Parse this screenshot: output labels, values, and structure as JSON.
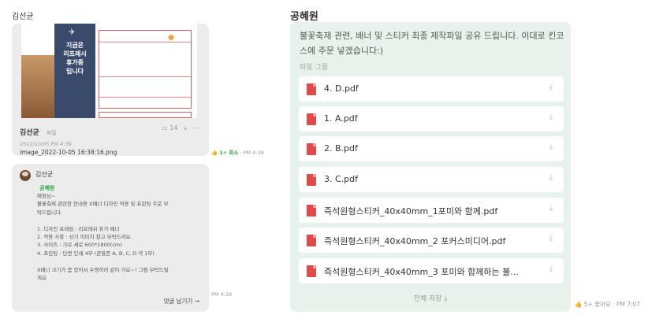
{
  "left": {
    "sender_top": "김선균",
    "image_message": {
      "thumb_lines": [
        "지금은",
        "리프레시",
        "휴가중",
        "입니다"
      ],
      "sender": "김선균",
      "type_label": "파일",
      "date": "2022/10/05 PM 4:39",
      "filename": "image_2022-10-05 16:38:16.png",
      "comment_count": "14",
      "reaction": "1+ 회소",
      "time": "PM 4:39"
    },
    "text_message": {
      "sender": "김선균",
      "mention": "공혜원",
      "body": "혜원님~\n불꽃축제 관련한 안내용 X배너 디자인 적용 및 프린팅 주문 부\n탁드립니다.\n\n1. 디자인 프레임 : 리프레쉬 휴가 배너\n2. 적용 사항 : 상기 이미지 참고 부탁드려요.\n3. 사이즈 : 가로 세로 600*1800(cm)\n4. 프린팅 : 단면 인쇄 4부 (관할존 A, B, C, D 각 1부)\n\nX배너 크기가 좀 있어서 수령하러 같이 가요~! 그럼 부탁드릴\n게요",
      "reply_label": "댓글 남기기 →",
      "time": "PM 4:39"
    }
  },
  "right": {
    "sender": "공혜원",
    "message": "불꽃축제 관련, 배너 및 스티커 최종 제작파일 공유 드립니다. 이대로 킨코스에 주문 넣겠습니다:)",
    "group_label": "파일 그룹",
    "files": [
      {
        "name": "4. D.pdf"
      },
      {
        "name": "1. A.pdf"
      },
      {
        "name": "2. B.pdf"
      },
      {
        "name": "3. C.pdf"
      },
      {
        "name": "즉석원형스티커_40x40mm_1포미와 함께.pdf"
      },
      {
        "name": "즉석원형스티커_40x40mm_2 포커스미디어.pdf"
      },
      {
        "name": "즉석원형스티커_40x40mm_3 포미와 함께하는 불..."
      }
    ],
    "save_all_label": "전체 저장 ⤓",
    "reaction": "5+ 좋아요 · PM 7:07"
  },
  "colors": {
    "bubble_left": "#ececec",
    "bubble_right": "#e8f2ec",
    "pdf_icon": "#e24a4a",
    "mention": "#2aa84a"
  },
  "icons": [
    "airplane-icon",
    "sun-icon",
    "pdf-icon",
    "download-icon",
    "comment-icon",
    "like-icon",
    "avatar"
  ]
}
